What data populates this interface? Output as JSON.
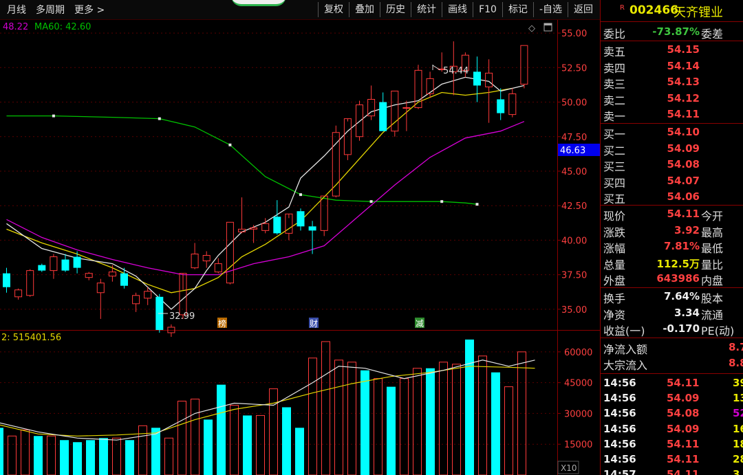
{
  "toolbar": {
    "left": [
      "月线",
      "多周期",
      "更多 >"
    ],
    "right": [
      "复权",
      "叠加",
      "历史",
      "统计",
      "画线",
      "F10",
      "标记",
      "-自选",
      "返回"
    ]
  },
  "legend": {
    "ma_a": "48.22",
    "ma60": "MA60: 42.60"
  },
  "volume_label": "2: 515401.56",
  "markers": {
    "bang": "榜",
    "cai": "财",
    "jian": "减",
    "vol_scale": "X10"
  },
  "colors": {
    "up": "#ff3a3a",
    "down": "#00ffff",
    "ma5": "#e6e6e6",
    "ma10": "#e6d700",
    "ma20": "#d800d8",
    "ma60": "#00c000"
  },
  "chart_data": {
    "type": "candlestick",
    "price_axis": {
      "min": 33.5,
      "max": 56.0,
      "ticks": [
        "55.00",
        "52.50",
        "50.00",
        "47.50",
        "45.00",
        "42.50",
        "40.00",
        "37.50",
        "35.00"
      ],
      "current": "46.63"
    },
    "volume_axis": {
      "max": 70000,
      "ticks": [
        "60000",
        "45000",
        "30000",
        "15000"
      ]
    },
    "annotations": {
      "high": "54.44",
      "low": "32.99"
    },
    "candles": [
      [
        37.6,
        38.0,
        36.2,
        36.6
      ],
      [
        35.9,
        36.5,
        35.7,
        36.4
      ],
      [
        36.0,
        37.9,
        35.9,
        37.8
      ],
      [
        38.2,
        38.3,
        37.7,
        37.8
      ],
      [
        37.8,
        39.0,
        37.2,
        38.8
      ],
      [
        38.6,
        39.0,
        37.7,
        37.8
      ],
      [
        38.8,
        39.2,
        37.6,
        38.0
      ],
      [
        37.3,
        37.7,
        37.1,
        37.6
      ],
      [
        36.2,
        37.2,
        34.3,
        36.9
      ],
      [
        37.4,
        38.2,
        37.0,
        37.7
      ],
      [
        37.6,
        38.0,
        36.5,
        36.7
      ],
      [
        35.4,
        36.2,
        34.8,
        36.0
      ],
      [
        35.8,
        36.6,
        35.3,
        36.3
      ],
      [
        35.9,
        36.1,
        33.3,
        33.5
      ],
      [
        33.3,
        33.9,
        33.0,
        33.7
      ],
      [
        34.6,
        36.4,
        34.3,
        37.6
      ],
      [
        38.0,
        39.8,
        37.9,
        39.0
      ],
      [
        38.5,
        39.2,
        38.0,
        38.9
      ],
      [
        37.7,
        38.7,
        37.6,
        38.3
      ],
      [
        36.9,
        41.3,
        36.8,
        41.3
      ],
      [
        40.6,
        43.1,
        40.5,
        40.8
      ],
      [
        40.8,
        41.1,
        39.8,
        40.9
      ],
      [
        40.7,
        41.6,
        40.5,
        41.2
      ],
      [
        41.7,
        42.9,
        40.4,
        40.5
      ],
      [
        40.5,
        41.6,
        40.0,
        41.9
      ],
      [
        42.1,
        42.3,
        40.7,
        41.0
      ],
      [
        41.0,
        41.4,
        39.0,
        40.7
      ],
      [
        40.7,
        43.2,
        40.3,
        43.2
      ],
      [
        43.2,
        48.3,
        43.1,
        47.8
      ],
      [
        46.2,
        48.6,
        45.8,
        48.8
      ],
      [
        47.5,
        50.1,
        47.2,
        49.8
      ],
      [
        49.0,
        51.2,
        48.7,
        50.2
      ],
      [
        50.0,
        50.7,
        49.3,
        47.9
      ],
      [
        47.9,
        50.8,
        47.5,
        50.8
      ],
      [
        49.6,
        50.1,
        47.9,
        49.6
      ],
      [
        49.6,
        52.7,
        49.5,
        52.3
      ],
      [
        50.6,
        52.2,
        50.3,
        51.7
      ],
      [
        52.4,
        53.6,
        52.2,
        52.4
      ],
      [
        52.2,
        54.4,
        50.5,
        52.6
      ],
      [
        52.3,
        53.6,
        51.8,
        53.4
      ],
      [
        52.2,
        53.3,
        50.0,
        51.2
      ],
      [
        51.1,
        53.1,
        48.5,
        52.1
      ],
      [
        50.2,
        51.0,
        48.7,
        49.2
      ],
      [
        49.1,
        51.0,
        48.9,
        50.6
      ],
      [
        51.3,
        54.1,
        51.0,
        54.1
      ]
    ],
    "volumes": [
      [
        23000,
        "d"
      ],
      [
        19000,
        "u"
      ],
      [
        22000,
        "u"
      ],
      [
        19000,
        "d"
      ],
      [
        19000,
        "u"
      ],
      [
        17000,
        "d"
      ],
      [
        16000,
        "d"
      ],
      [
        17000,
        "d"
      ],
      [
        18000,
        "d"
      ],
      [
        18000,
        "u"
      ],
      [
        17000,
        "d"
      ],
      [
        24000,
        "u"
      ],
      [
        23000,
        "d"
      ],
      [
        18000,
        "u"
      ],
      [
        36000,
        "u"
      ],
      [
        37000,
        "u"
      ],
      [
        27000,
        "d"
      ],
      [
        44000,
        "d"
      ],
      [
        34000,
        "u"
      ],
      [
        29000,
        "d"
      ],
      [
        29000,
        "u"
      ],
      [
        42000,
        "u"
      ],
      [
        33000,
        "d"
      ],
      [
        23000,
        "d"
      ],
      [
        57000,
        "u"
      ],
      [
        65000,
        "u"
      ],
      [
        56000,
        "u"
      ],
      [
        55000,
        "u"
      ],
      [
        51000,
        "d"
      ],
      [
        47000,
        "u"
      ],
      [
        43000,
        "d"
      ],
      [
        47000,
        "u"
      ],
      [
        52000,
        "u"
      ],
      [
        52000,
        "d"
      ],
      [
        55000,
        "u"
      ],
      [
        54000,
        "u"
      ],
      [
        66000,
        "d"
      ],
      [
        58000,
        "u"
      ],
      [
        50000,
        "d"
      ],
      [
        43000,
        "u"
      ],
      [
        60000,
        "u"
      ]
    ],
    "ma5": [
      [
        0,
        41.2
      ],
      [
        3,
        39.4
      ],
      [
        6,
        38.7
      ],
      [
        9,
        38.3
      ],
      [
        11,
        37.4
      ],
      [
        13,
        35.8
      ],
      [
        14,
        35.0
      ],
      [
        16,
        36.5
      ],
      [
        17,
        37.8
      ],
      [
        18,
        38.9
      ],
      [
        20,
        40.6
      ],
      [
        22,
        41.3
      ],
      [
        24,
        42.4
      ],
      [
        25,
        44.5
      ],
      [
        27,
        46.1
      ],
      [
        29,
        47.9
      ],
      [
        31,
        49.3
      ],
      [
        33,
        49.8
      ],
      [
        35,
        50.1
      ],
      [
        37,
        51.3
      ],
      [
        39,
        51.8
      ],
      [
        41,
        51.5
      ],
      [
        42,
        50.8
      ],
      [
        44,
        51.2
      ]
    ],
    "ma10": [
      [
        0,
        40.8
      ],
      [
        3,
        39.8
      ],
      [
        6,
        39.0
      ],
      [
        9,
        38.0
      ],
      [
        12,
        36.8
      ],
      [
        14,
        36.2
      ],
      [
        16,
        36.5
      ],
      [
        18,
        37.3
      ],
      [
        20,
        38.8
      ],
      [
        22,
        39.7
      ],
      [
        25,
        41.4
      ],
      [
        28,
        44.0
      ],
      [
        30,
        45.9
      ],
      [
        32,
        47.8
      ],
      [
        35,
        50.0
      ],
      [
        37,
        50.7
      ],
      [
        39,
        50.5
      ],
      [
        41,
        50.7
      ],
      [
        43,
        51.0
      ]
    ],
    "ma20": [
      [
        0,
        41.5
      ],
      [
        3,
        40.2
      ],
      [
        6,
        39.3
      ],
      [
        9,
        38.6
      ],
      [
        12,
        38.0
      ],
      [
        15,
        37.5
      ],
      [
        18,
        37.5
      ],
      [
        21,
        38.3
      ],
      [
        24,
        38.8
      ],
      [
        27,
        39.6
      ],
      [
        30,
        41.8
      ],
      [
        33,
        44.0
      ],
      [
        36,
        46.0
      ],
      [
        39,
        47.4
      ],
      [
        42,
        47.9
      ],
      [
        44,
        48.6
      ]
    ],
    "ma60": [
      [
        0,
        49.0
      ],
      [
        4,
        49.0
      ],
      [
        9,
        48.9
      ],
      [
        13,
        48.8
      ],
      [
        16,
        48.2
      ],
      [
        19,
        46.9
      ],
      [
        22,
        44.6
      ],
      [
        25,
        43.3
      ],
      [
        28,
        42.9
      ],
      [
        31,
        42.8
      ],
      [
        34,
        42.8
      ],
      [
        37,
        42.8
      ],
      [
        39,
        42.7
      ],
      [
        40,
        42.6
      ]
    ],
    "vol_ma5": [
      [
        0,
        25500
      ],
      [
        3,
        21000
      ],
      [
        6,
        18000
      ],
      [
        9,
        17000
      ],
      [
        12,
        20000
      ],
      [
        15,
        30000
      ],
      [
        18,
        35000
      ],
      [
        21,
        34000
      ],
      [
        24,
        45000
      ],
      [
        26,
        53000
      ],
      [
        28,
        52000
      ],
      [
        31,
        47000
      ],
      [
        34,
        51000
      ],
      [
        37,
        56000
      ],
      [
        39,
        53000
      ],
      [
        41,
        56000
      ]
    ],
    "vol_ma10": [
      [
        0,
        24500
      ],
      [
        3,
        20000
      ],
      [
        6,
        19000
      ],
      [
        9,
        19500
      ],
      [
        12,
        20500
      ],
      [
        15,
        27000
      ],
      [
        18,
        32000
      ],
      [
        21,
        35000
      ],
      [
        24,
        40000
      ],
      [
        27,
        44500
      ],
      [
        30,
        48000
      ],
      [
        33,
        50000
      ],
      [
        36,
        53000
      ],
      [
        39,
        52500
      ],
      [
        41,
        52000
      ]
    ]
  },
  "quote": {
    "r_tag": "R",
    "code": "002466",
    "name": "天齐锂业",
    "weibi_label": "委比",
    "weibi_value": "-73.87%",
    "weicha_label": "委差",
    "asks": [
      {
        "label": "卖五",
        "price": "54.15"
      },
      {
        "label": "卖四",
        "price": "54.14"
      },
      {
        "label": "卖三",
        "price": "54.13"
      },
      {
        "label": "卖二",
        "price": "54.12"
      },
      {
        "label": "卖一",
        "price": "54.11"
      }
    ],
    "bids": [
      {
        "label": "买一",
        "price": "54.10"
      },
      {
        "label": "买二",
        "price": "54.09"
      },
      {
        "label": "买三",
        "price": "54.08"
      },
      {
        "label": "买四",
        "price": "54.07"
      },
      {
        "label": "买五",
        "price": "54.06"
      }
    ],
    "stats": [
      {
        "l1": "现价",
        "v": "54.11",
        "c": "red",
        "l2": "今开"
      },
      {
        "l1": "涨跌",
        "v": "3.92",
        "c": "red",
        "l2": "最高"
      },
      {
        "l1": "涨幅",
        "v": "7.81%",
        "c": "red",
        "l2": "最低"
      },
      {
        "l1": "总量",
        "v": "112.5万",
        "c": "yellow",
        "l2": "量比"
      },
      {
        "l1": "外盘",
        "v": "643986",
        "c": "red",
        "l2": "内盘"
      }
    ],
    "stats2": [
      {
        "l1": "换手",
        "v": "7.64%",
        "c": "white",
        "l2": "股本"
      },
      {
        "l1": "净资",
        "v": "3.34",
        "c": "white",
        "l2": "流通"
      },
      {
        "l1": "收益(一)",
        "v": "-0.170",
        "c": "white",
        "l2": "PE(动)"
      }
    ],
    "flows": [
      {
        "label": "净流入额",
        "value": "8.7"
      },
      {
        "label": "大宗流入",
        "value": "8.8"
      }
    ],
    "ticks": [
      {
        "t": "14:56",
        "p": "54.11",
        "v": "39",
        "c": "#e8e800"
      },
      {
        "t": "14:56",
        "p": "54.09",
        "v": "13",
        "c": "#e8e800"
      },
      {
        "t": "14:56",
        "p": "54.08",
        "v": "52",
        "c": "#d000d0"
      },
      {
        "t": "14:56",
        "p": "54.09",
        "v": "16",
        "c": "#e8e800"
      },
      {
        "t": "14:56",
        "p": "54.11",
        "v": "18",
        "c": "#e8e800"
      },
      {
        "t": "14:56",
        "p": "54.11",
        "v": "28",
        "c": "#e8e800"
      },
      {
        "t": "14:57",
        "p": "54.11",
        "v": "3",
        "c": "#e8e800"
      }
    ]
  }
}
